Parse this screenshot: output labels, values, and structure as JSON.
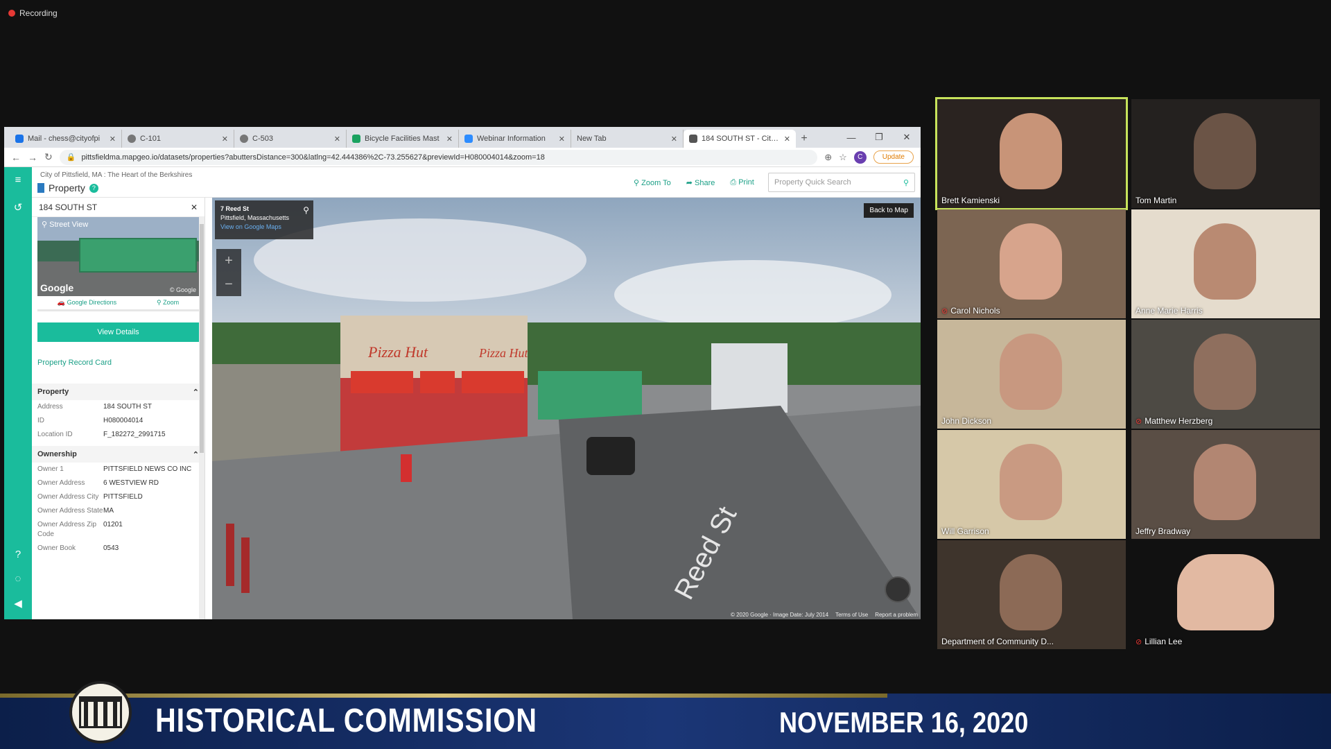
{
  "recording": {
    "label": "Recording"
  },
  "browser": {
    "tabs": [
      {
        "label": "Mail - chess@cityofpi"
      },
      {
        "label": "C-101"
      },
      {
        "label": "C-503"
      },
      {
        "label": "Bicycle Facilities Mast"
      },
      {
        "label": "Webinar Information"
      },
      {
        "label": "New Tab"
      },
      {
        "label": "184 SOUTH ST - City o"
      }
    ],
    "url": "pittsfieldma.mapgeo.io/datasets/properties?abuttersDistance=300&latlng=42.444386%2C-73.255627&previewId=H080004014&zoom=18",
    "update_label": "Update",
    "profile_initial": "C"
  },
  "app": {
    "breadcrumb": "City of Pittsfield, MA : The Heart of the Berkshires",
    "page_title": "Property",
    "zoom_to": "Zoom To",
    "share": "Share",
    "print": "Print",
    "search_placeholder": "Property Quick Search"
  },
  "panel": {
    "title": "184 SOUTH ST",
    "street_view_label": "Street View",
    "google_logo": "Google",
    "google_small": "© Google",
    "directions": "Google Directions",
    "zoom": "Zoom",
    "view_details": "View Details",
    "record_card": "Property Record Card",
    "property_section": "Property",
    "property_rows": [
      {
        "k": "Address",
        "v": "184 SOUTH ST"
      },
      {
        "k": "ID",
        "v": "H080004014"
      },
      {
        "k": "Location ID",
        "v": "F_182272_2991715"
      }
    ],
    "ownership_section": "Ownership",
    "ownership_rows": [
      {
        "k": "Owner 1",
        "v": "PITTSFIELD NEWS CO INC"
      },
      {
        "k": "Owner Address",
        "v": "6 WESTVIEW RD"
      },
      {
        "k": "Owner Address City",
        "v": "PITTSFIELD"
      },
      {
        "k": "Owner Address State",
        "v": "MA"
      },
      {
        "k": "Owner Address Zip Code",
        "v": "01201"
      },
      {
        "k": "Owner Book",
        "v": "0543"
      }
    ]
  },
  "streetview": {
    "street": "7 Reed St",
    "city": "Pittsfield, Massachusetts",
    "maps_link": "View on Google Maps",
    "back_to_map": "Back to Map",
    "road_label": "Reed St",
    "sign1": "Pizza Hut",
    "sign2": "Pizza Hut",
    "attribution": "© 2020 Google · Image Date: July 2014",
    "terms": "Terms of Use",
    "report": "Report a problem"
  },
  "participants": [
    {
      "name": "Brett Kamienski",
      "muted": false,
      "active": true
    },
    {
      "name": "Tom Martin",
      "muted": false,
      "active": false
    },
    {
      "name": "Carol Nichols",
      "muted": true,
      "active": false
    },
    {
      "name": "Anne Marie Harris",
      "muted": false,
      "active": false
    },
    {
      "name": "John Dickson",
      "muted": false,
      "active": false
    },
    {
      "name": "Matthew Herzberg",
      "muted": true,
      "active": false
    },
    {
      "name": "Will Garrison",
      "muted": false,
      "active": false
    },
    {
      "name": "Jeffry Bradway",
      "muted": false,
      "active": false
    },
    {
      "name": "Department of Community D...",
      "muted": false,
      "active": false
    },
    {
      "name": "Lillian Lee",
      "muted": true,
      "active": false
    }
  ],
  "banner": {
    "title": "HISTORICAL COMMISSION",
    "date": "NOVEMBER 16, 2020"
  }
}
